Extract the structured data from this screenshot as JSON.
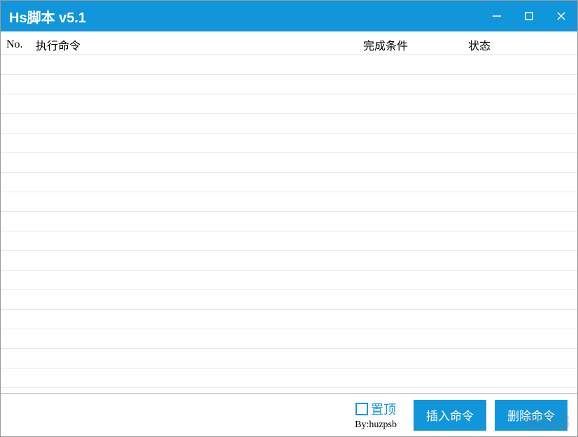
{
  "window": {
    "title": "Hs脚本 v5.1"
  },
  "table": {
    "headers": {
      "no": "No.",
      "command": "执行命令",
      "condition": "完成条件",
      "status": "状态"
    },
    "row_count": 17
  },
  "footer": {
    "pin_label": "置顶",
    "byline": "By:huzpsb",
    "insert_label": "插入命令",
    "delete_label": "删除命令"
  },
  "watermark": "9553"
}
